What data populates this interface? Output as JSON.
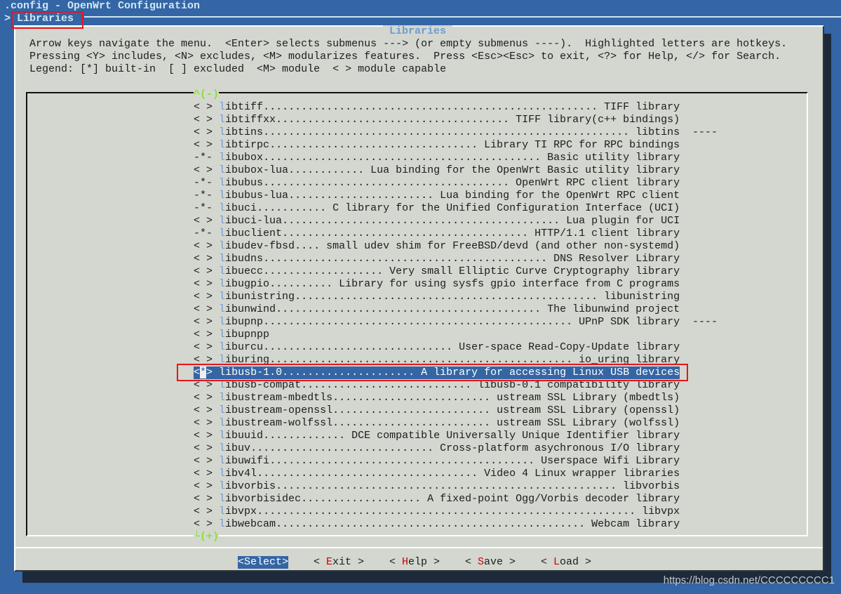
{
  "window": {
    "title": ".config - OpenWrt Configuration",
    "breadcrumb_marker": ">",
    "breadcrumb": "Libraries"
  },
  "dialog": {
    "title": "Libraries",
    "help_lines": [
      "Arrow keys navigate the menu.  <Enter> selects submenus ---> (or empty submenus ----).  Highlighted letters are hotkeys.",
      "Pressing <Y> includes, <N> excludes, <M> modularizes features.  Press <Esc><Esc> to exit, <?> for Help, </> for Search.",
      "Legend: [*] built-in  [ ] excluded  <M> module  < > module capable"
    ],
    "scroll_up": "^(-)",
    "scroll_down": "└(+)",
    "items": [
      {
        "prefix": "< >",
        "name": "libtiff",
        "desc": "TIFF library"
      },
      {
        "prefix": "< >",
        "name": "libtiffxx",
        "desc": "TIFF library(c++ bindings)"
      },
      {
        "prefix": "< >",
        "name": "libtins",
        "desc": "libtins",
        "suffix": "----"
      },
      {
        "prefix": "< >",
        "name": "libtirpc",
        "desc": "Library TI RPC for RPC bindings"
      },
      {
        "prefix": "-*-",
        "name": "libubox",
        "desc": "Basic utility library"
      },
      {
        "prefix": "< >",
        "name": "libubox-lua",
        "desc": "Lua binding for the OpenWrt Basic utility library"
      },
      {
        "prefix": "-*-",
        "name": "libubus",
        "desc": "OpenWrt RPC client library"
      },
      {
        "prefix": "-*-",
        "name": "libubus-lua",
        "desc": "Lua binding for the OpenWrt RPC client"
      },
      {
        "prefix": "-*-",
        "name": "libuci",
        "desc": "C library for the Unified Configuration Interface (UCI)"
      },
      {
        "prefix": "< >",
        "name": "libuci-lua",
        "desc": "Lua plugin for UCI"
      },
      {
        "prefix": "-*-",
        "name": "libuclient",
        "desc": "HTTP/1.1 client library"
      },
      {
        "prefix": "< >",
        "name": "libudev-fbsd",
        "desc": "small udev shim for FreeBSD/devd (and other non-systemd)"
      },
      {
        "prefix": "< >",
        "name": "libudns",
        "desc": "DNS Resolver Library"
      },
      {
        "prefix": "< >",
        "name": "libuecc",
        "desc": "Very small Elliptic Curve Cryptography library"
      },
      {
        "prefix": "< >",
        "name": "libugpio",
        "desc": "Library for using sysfs gpio interface from C programs"
      },
      {
        "prefix": "< >",
        "name": "libunistring",
        "desc": "libunistring"
      },
      {
        "prefix": "< >",
        "name": "libunwind",
        "desc": "The libunwind project"
      },
      {
        "prefix": "< >",
        "name": "libupnp",
        "desc": "UPnP SDK library",
        "suffix": "----"
      },
      {
        "prefix": "< >",
        "name": "libupnpp",
        "desc": ""
      },
      {
        "prefix": "< >",
        "name": "liburcu",
        "desc": "User-space Read-Copy-Update library"
      },
      {
        "prefix": "< >",
        "name": "liburing",
        "desc": "io_uring library"
      },
      {
        "prefix": "<*>",
        "name": "libusb-1.0",
        "desc": "A library for accessing Linux USB devices",
        "selected": true
      },
      {
        "prefix": "< >",
        "name": "libusb-compat",
        "desc": "libusb-0.1 compatibility library"
      },
      {
        "prefix": "< >",
        "name": "libustream-mbedtls",
        "desc": "ustream SSL Library (mbedtls)"
      },
      {
        "prefix": "< >",
        "name": "libustream-openssl",
        "desc": "ustream SSL Library (openssl)"
      },
      {
        "prefix": "< >",
        "name": "libustream-wolfssl",
        "desc": "ustream SSL Library (wolfssl)"
      },
      {
        "prefix": "< >",
        "name": "libuuid",
        "desc": "DCE compatible Universally Unique Identifier library"
      },
      {
        "prefix": "< >",
        "name": "libuv",
        "desc": "Cross-platform asychronous I/O library"
      },
      {
        "prefix": "< >",
        "name": "libuwifi",
        "desc": "Userspace Wifi Library"
      },
      {
        "prefix": "< >",
        "name": "libv4l",
        "desc": "Video 4 Linux wrapper libraries"
      },
      {
        "prefix": "< >",
        "name": "libvorbis",
        "desc": "libvorbis"
      },
      {
        "prefix": "< >",
        "name": "libvorbisidec",
        "desc": "A fixed-point Ogg/Vorbis decoder library"
      },
      {
        "prefix": "< >",
        "name": "libvpx",
        "desc": "libvpx"
      },
      {
        "prefix": "< >",
        "name": "libwebcam",
        "desc": "Webcam library"
      }
    ],
    "buttons": [
      {
        "text": "<Select>",
        "hotkey": "S",
        "selected": true
      },
      {
        "text": "< Exit >",
        "hotkey": "E"
      },
      {
        "text": "< Help >",
        "hotkey": "H"
      },
      {
        "text": "< Save >",
        "hotkey": "S"
      },
      {
        "text": "< Load >",
        "hotkey": "L"
      }
    ]
  },
  "watermark": "https://blog.csdn.net/CCCCCCCCC1",
  "colors": {
    "screen_bg": "#3465a4",
    "dialog_bg": "#d3d7cf",
    "highlight_bg": "#3465a4",
    "hotkey": "#cc0000",
    "item_hotkey": "#6f9bd1",
    "scroll_indicator": "#8ae234",
    "annotation": "#e8151b"
  }
}
